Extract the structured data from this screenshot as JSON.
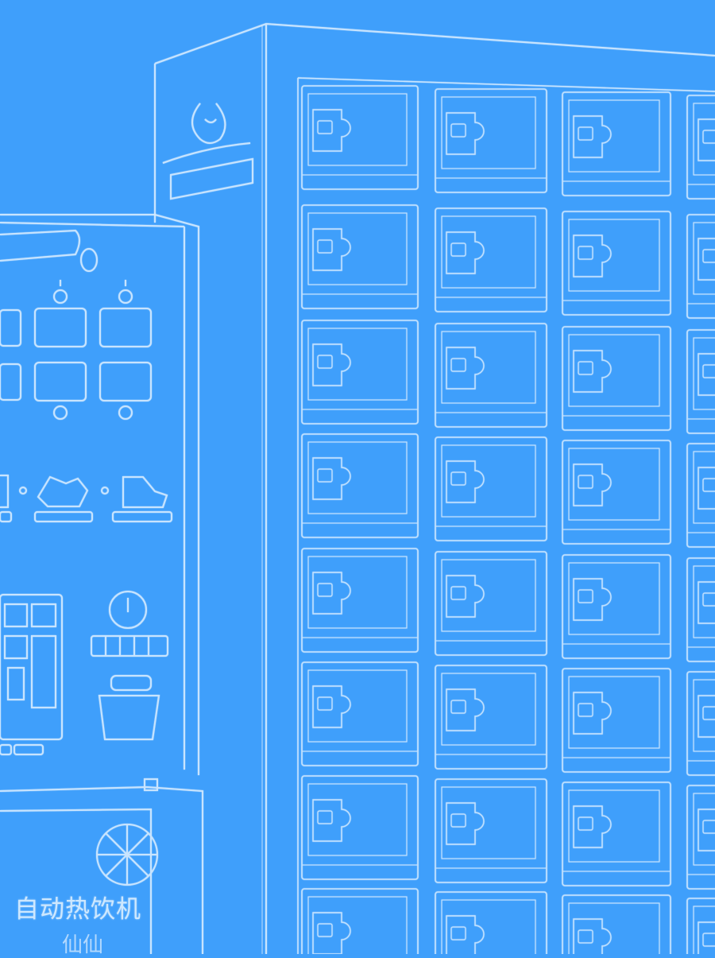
{
  "image": {
    "background_color": "#3f9ffb",
    "line_color": "#cfe7ff"
  },
  "texts": {
    "machine_name_cn": "自动热饮机",
    "machine_name_sub": "仙仙"
  },
  "icons": {
    "logo": "cup-flame-icon",
    "qr": "qr-code-icon",
    "coin_slot": "coin-slot-icon",
    "cup": "cup-icon"
  }
}
